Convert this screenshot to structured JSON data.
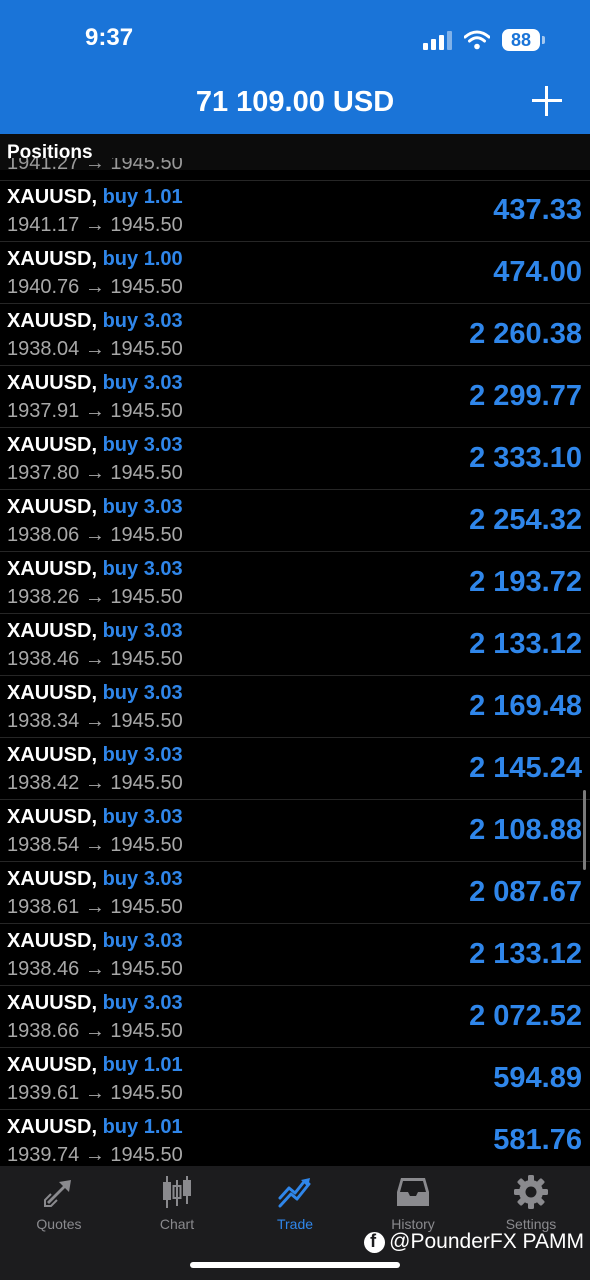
{
  "status_bar": {
    "time": "9:37",
    "battery": "88"
  },
  "header": {
    "balance": "71 109.00 USD"
  },
  "section": {
    "title": "Positions"
  },
  "partial_row_text": "1941.27 → 1945.50",
  "positions": [
    {
      "symbol": "XAUUSD,",
      "direction": "buy 1.01",
      "prices": "1941.17 → 1945.50",
      "profit": "437.33"
    },
    {
      "symbol": "XAUUSD,",
      "direction": "buy 1.00",
      "prices": "1940.76 → 1945.50",
      "profit": "474.00"
    },
    {
      "symbol": "XAUUSD,",
      "direction": "buy 3.03",
      "prices": "1938.04 → 1945.50",
      "profit": "2 260.38"
    },
    {
      "symbol": "XAUUSD,",
      "direction": "buy 3.03",
      "prices": "1937.91 → 1945.50",
      "profit": "2 299.77"
    },
    {
      "symbol": "XAUUSD,",
      "direction": "buy 3.03",
      "prices": "1937.80 → 1945.50",
      "profit": "2 333.10"
    },
    {
      "symbol": "XAUUSD,",
      "direction": "buy 3.03",
      "prices": "1938.06 → 1945.50",
      "profit": "2 254.32"
    },
    {
      "symbol": "XAUUSD,",
      "direction": "buy 3.03",
      "prices": "1938.26 → 1945.50",
      "profit": "2 193.72"
    },
    {
      "symbol": "XAUUSD,",
      "direction": "buy 3.03",
      "prices": "1938.46 → 1945.50",
      "profit": "2 133.12"
    },
    {
      "symbol": "XAUUSD,",
      "direction": "buy 3.03",
      "prices": "1938.34 → 1945.50",
      "profit": "2 169.48"
    },
    {
      "symbol": "XAUUSD,",
      "direction": "buy 3.03",
      "prices": "1938.42 → 1945.50",
      "profit": "2 145.24"
    },
    {
      "symbol": "XAUUSD,",
      "direction": "buy 3.03",
      "prices": "1938.54 → 1945.50",
      "profit": "2 108.88"
    },
    {
      "symbol": "XAUUSD,",
      "direction": "buy 3.03",
      "prices": "1938.61 → 1945.50",
      "profit": "2 087.67"
    },
    {
      "symbol": "XAUUSD,",
      "direction": "buy 3.03",
      "prices": "1938.46 → 1945.50",
      "profit": "2 133.12"
    },
    {
      "symbol": "XAUUSD,",
      "direction": "buy 3.03",
      "prices": "1938.66 → 1945.50",
      "profit": "2 072.52"
    },
    {
      "symbol": "XAUUSD,",
      "direction": "buy 1.01",
      "prices": "1939.61 → 1945.50",
      "profit": "594.89"
    },
    {
      "symbol": "XAUUSD,",
      "direction": "buy 1.01",
      "prices": "1939.74 → 1945.50",
      "profit": "581.76"
    }
  ],
  "tabs": [
    {
      "label": "Quotes",
      "icon": "quotes-arrows-icon",
      "active": false
    },
    {
      "label": "Chart",
      "icon": "candlestick-icon",
      "active": false
    },
    {
      "label": "Trade",
      "icon": "trade-trend-icon",
      "active": true
    },
    {
      "label": "History",
      "icon": "inbox-tray-icon",
      "active": false
    },
    {
      "label": "Settings",
      "icon": "gear-icon",
      "active": false
    }
  ],
  "watermark": "@PounderFX PAMM",
  "colors": {
    "header_bg": "#1a74d8",
    "accent": "#2f86ea",
    "background": "#000000"
  }
}
